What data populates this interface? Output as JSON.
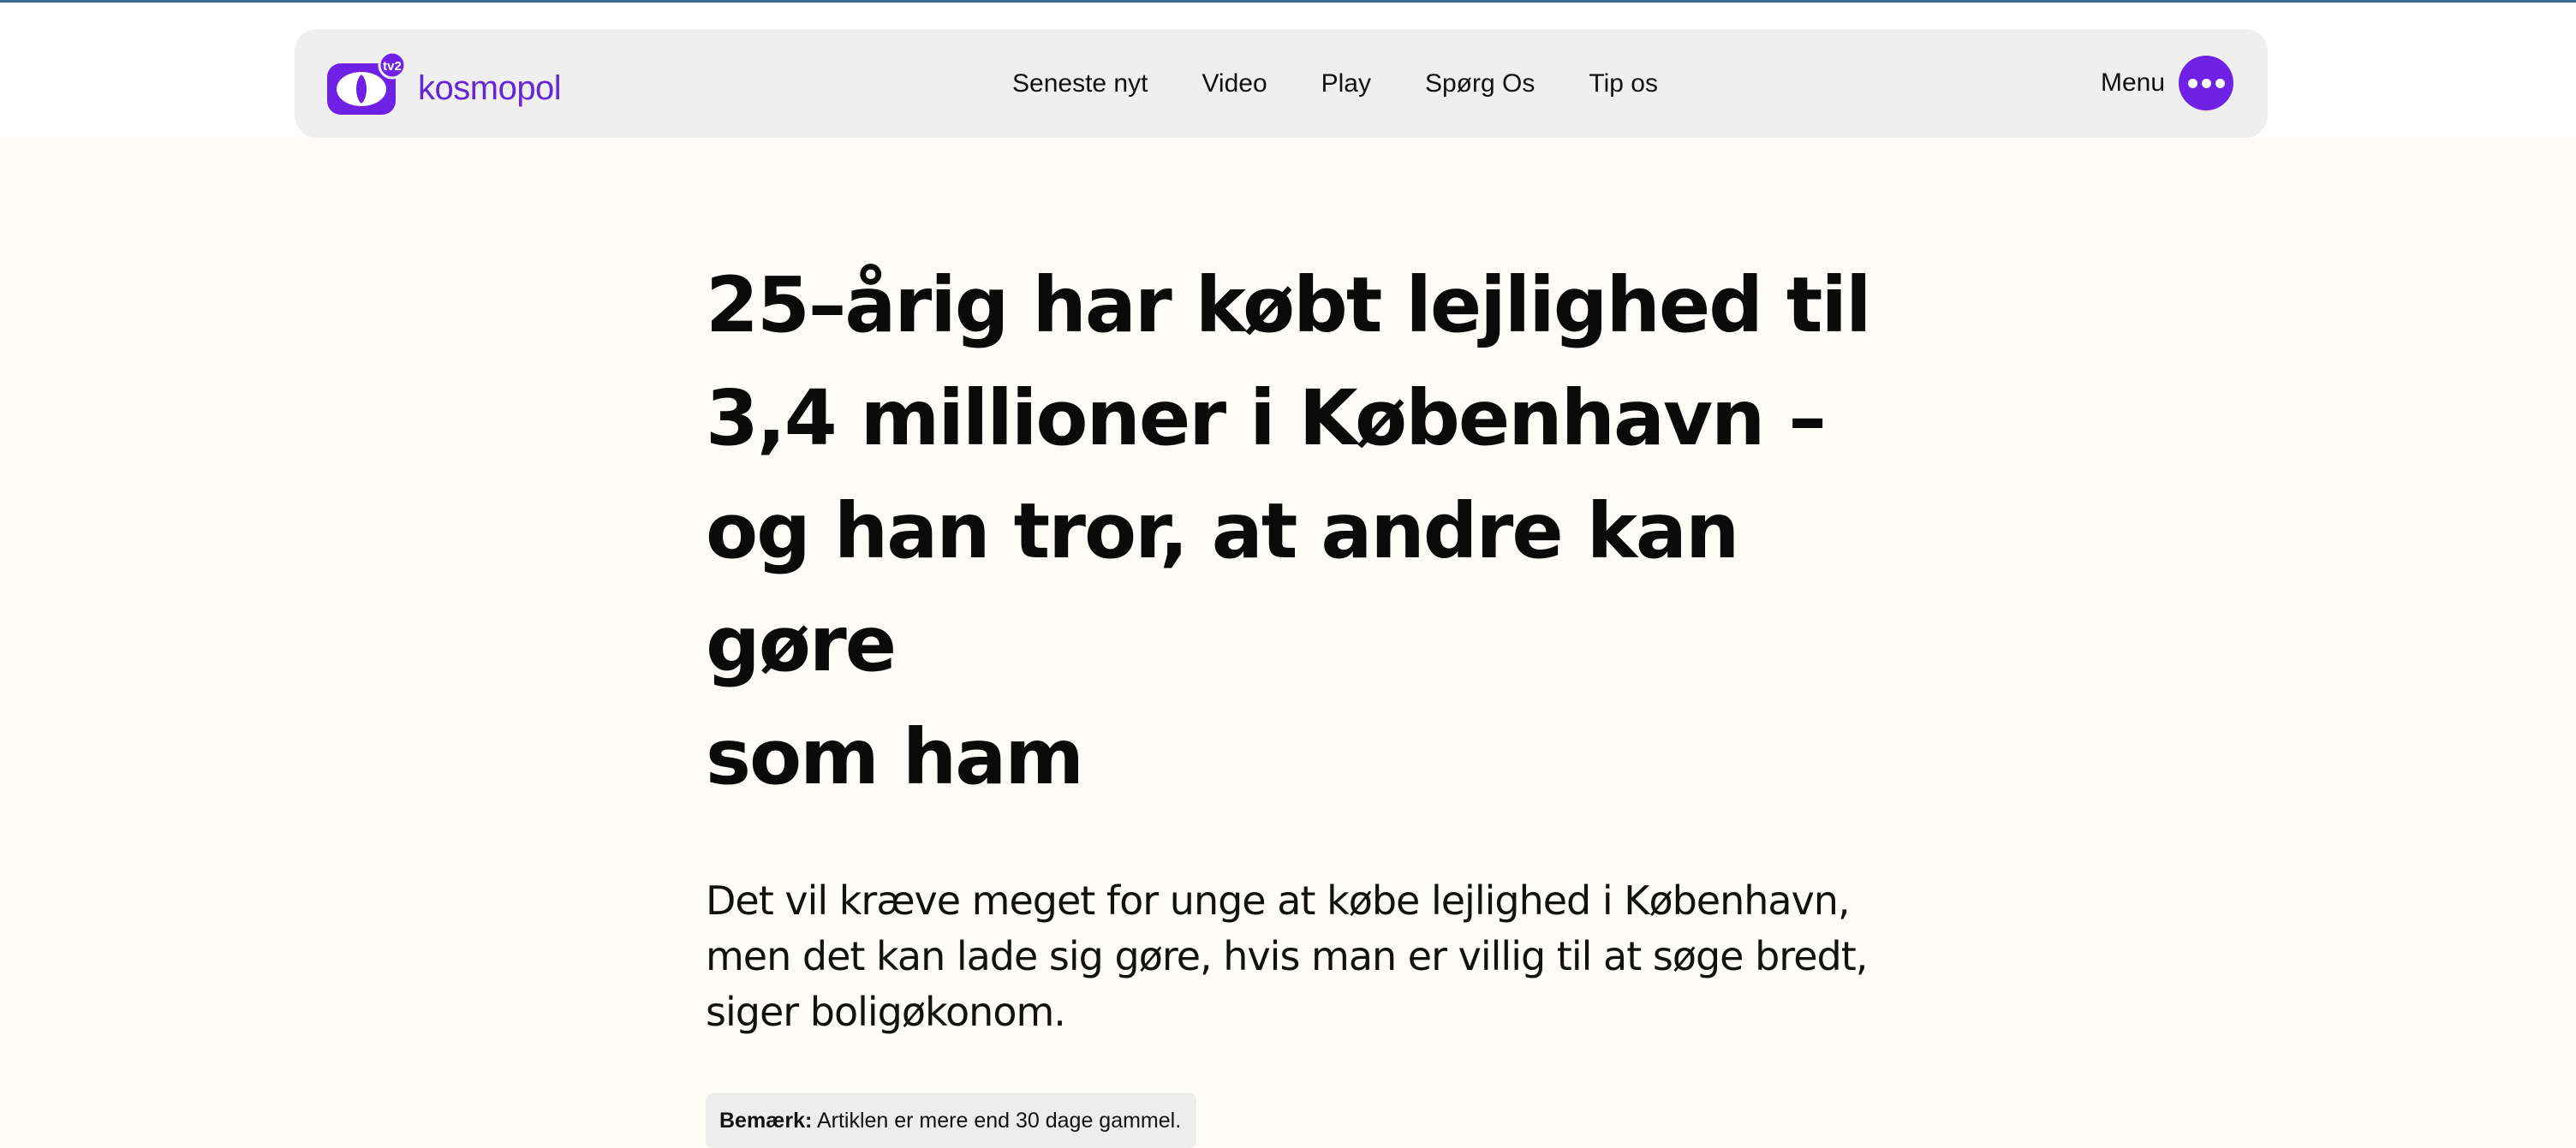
{
  "header": {
    "logo_text": "kosmopol",
    "logo_badge": "tv2",
    "nav": [
      "Seneste nyt",
      "Video",
      "Play",
      "Spørg Os",
      "Tip os"
    ],
    "menu_label": "Menu"
  },
  "article": {
    "headline_lines": [
      "25–årig har købt lejlighed til",
      "3,4 millioner i København –",
      "og han tror, at andre kan gøre",
      "som ham"
    ],
    "lead_lines": [
      "Det vil kræve meget for unge at købe lejlighed i København,",
      "men det kan lade sig gøre, hvis man er villig til at søge bredt,",
      "siger boligøkonom."
    ],
    "notice_label": "Bemærk:",
    "notice_text": " Artiklen er mere end 30 dage gammel."
  },
  "colors": {
    "brand": "#6f22e6",
    "logo_text": "#6528d8",
    "page_background": "#fdfcf8",
    "navbar_background": "#efefef"
  }
}
